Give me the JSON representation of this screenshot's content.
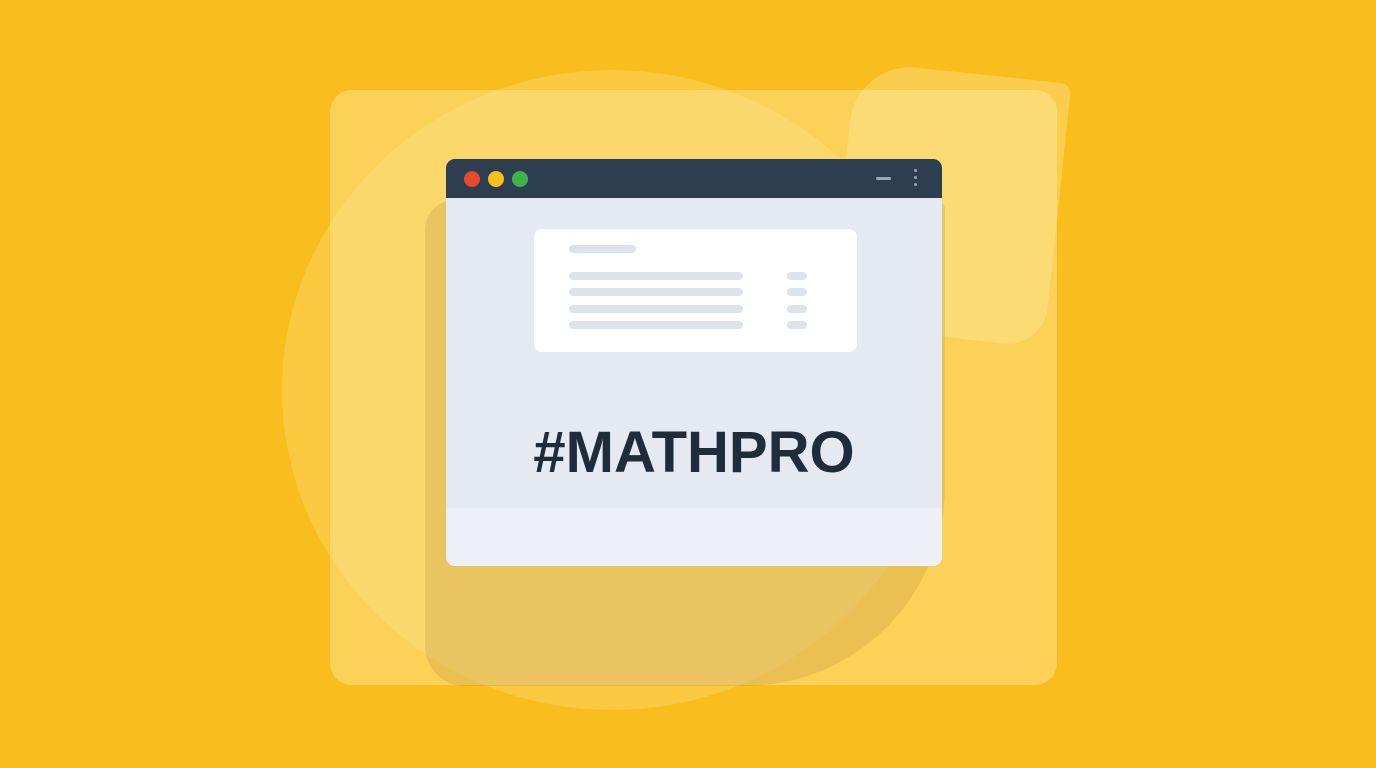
{
  "window": {
    "controls": {
      "close_color": "#e8492a",
      "minimize_color": "#f4c21a",
      "maximize_color": "#3db34a",
      "right_icons": [
        "minimize-icon",
        "more-vertical-icon"
      ]
    },
    "card": {
      "icon_names": [
        "placeholder-line",
        "placeholder-list-line",
        "placeholder-list-tag"
      ]
    },
    "hashtag": "#MATHPRO"
  },
  "colors": {
    "background": "#f9be1e",
    "titlebar": "#2c3e50",
    "text": "#1f2c3a"
  }
}
